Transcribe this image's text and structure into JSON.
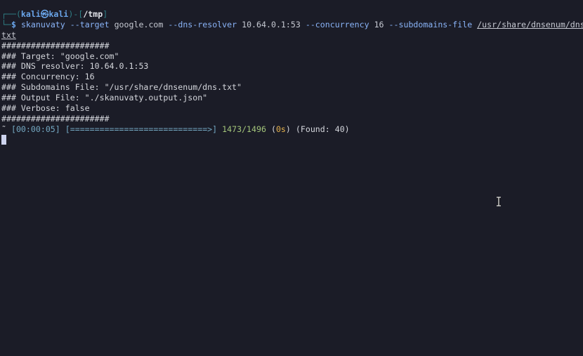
{
  "prompt": {
    "corner_top": "┌──(",
    "user": "kali",
    "at": "㉿",
    "host": "kali",
    "sep": ")-[",
    "path": "/tmp",
    "close": "]",
    "corner_bottom": "└─",
    "symbol": "$"
  },
  "command": {
    "program": "skanuvaty",
    "flag_target": "--target",
    "target": "google.com",
    "flag_resolver": "--dns-resolver",
    "resolver": "10.64.0.1:53",
    "flag_concurrency": "--concurrency",
    "concurrency": "16",
    "flag_subdomains": "--subdomains-file",
    "file_part1": "/usr/share/dnsenum/dns.",
    "file_part2": "txt"
  },
  "output": {
    "banner": "######################",
    "target_line": "### Target: \"google.com\"",
    "resolver_line": "### DNS resolver: 10.64.0.1:53",
    "concurrency_line": "### Concurrency: 16",
    "subdomains_line": "### Subdomains File: \"/usr/share/dnsenum/dns.txt\"",
    "output_line": "### Output File: \"./skanuvaty.output.json\"",
    "verbose_line": "### Verbose: false",
    "banner_end": "######################"
  },
  "progress": {
    "spinner": "˜",
    "elapsed": "[00:00:05]",
    "bar": "[============================>]",
    "done": "1473",
    "total": "1496",
    "open_paren": "(",
    "eta": "0s",
    "close_paren": ")",
    "found": "(Found: 40)"
  }
}
